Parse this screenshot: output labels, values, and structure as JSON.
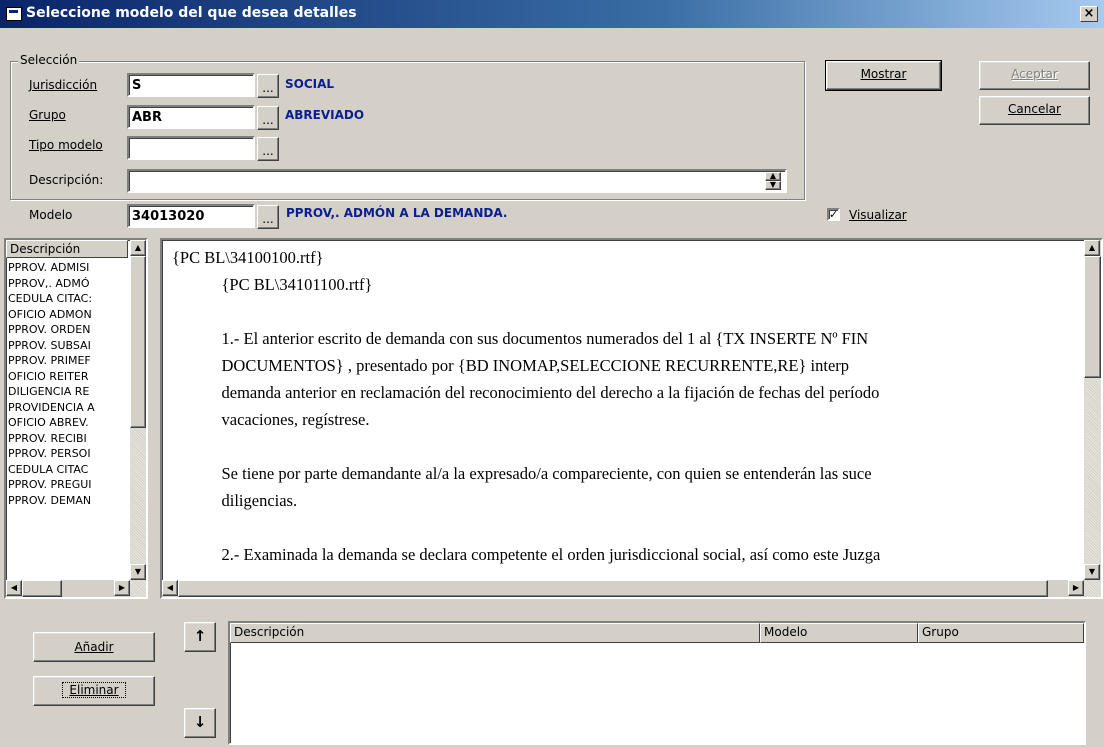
{
  "window": {
    "title": "Seleccione modelo del que desea detalles",
    "close_label": "×"
  },
  "seleccion": {
    "legend": "Selección",
    "jurisdiccion": {
      "label": "Jurisdicción",
      "value": "S",
      "desc": "SOCIAL"
    },
    "grupo": {
      "label": "Grupo",
      "value": "ABR",
      "desc": "ABREVIADO"
    },
    "tipo_modelo": {
      "label": "Tipo modelo",
      "value": ""
    },
    "descripcion": {
      "label": "Descripción:",
      "value": ""
    }
  },
  "modelo": {
    "label": "Modelo",
    "value": "34013020",
    "desc": "PPROV,. ADMÓN A LA DEMANDA."
  },
  "browse_label": "...",
  "buttons": {
    "mostrar": "Mostrar",
    "aceptar": "Aceptar",
    "cancelar": "Cancelar",
    "anadir": "Añadir",
    "eliminar": "Eliminar",
    "up": "↑",
    "down": "↓"
  },
  "visualizar": {
    "label": "Visualizar",
    "checked": true,
    "mark": "✓"
  },
  "list": {
    "header": "Descripción",
    "items": [
      "PPROV. ADMISI",
      "PPROV,. ADMÓ",
      "CEDULA CITAC:",
      "OFICIO ADMON",
      "PPROV. ORDEN",
      "PPROV. SUBSAI",
      "PPROV. PRIMEF",
      "OFICIO REITER",
      "DILIGENCIA RE",
      "PROVIDENCIA A",
      "OFICIO ABREV.",
      "PPROV. RECIBI",
      "PPROV. PERSOI",
      "CEDULA CITAC",
      "PPROV. PREGUI",
      "PPROV. DEMAN"
    ]
  },
  "document": {
    "lines": [
      "{PC BL\\34100100.rtf}",
      "            {PC BL\\34101100.rtf}",
      "",
      "            1.- El anterior escrito de demanda con sus documentos numerados del 1 al {TX INSERTE Nº FIN",
      "            DOCUMENTOS} , presentado por {BD INOMAP,SELECCIONE RECURRENTE,RE} interp",
      "            demanda anterior en reclamación del reconocimiento del derecho a la fijación de fechas del período",
      "            vacaciones, regístrese.",
      "",
      "            Se tiene por parte demandante al/a la expresado/a compareciente, con quien se entenderán las suce",
      "            diligencias.",
      "",
      "            2.- Examinada la demanda se declara competente el orden jurisdiccional social, así como este Juzga",
      "            ..."
    ]
  },
  "table": {
    "columns": [
      "Descripción",
      "Modelo",
      "Grupo"
    ]
  }
}
